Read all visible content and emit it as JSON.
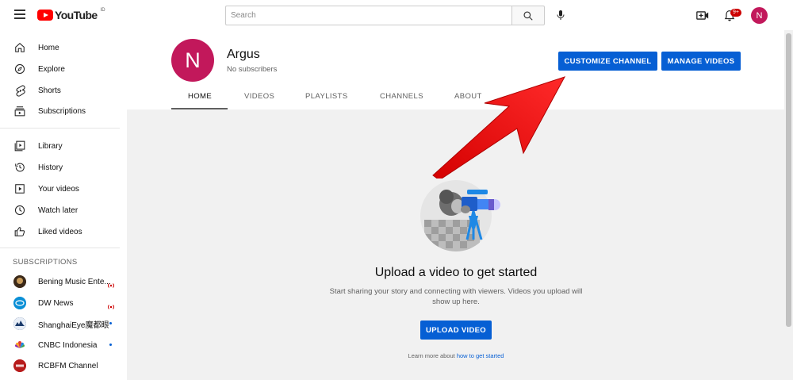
{
  "topbar": {
    "logo_text": "YouTube",
    "logo_region": "ID",
    "search_placeholder": "Search",
    "notification_count": "9+",
    "avatar_initial": "N"
  },
  "sidebar": {
    "main_items": [
      {
        "label": "Home",
        "icon": "home-icon"
      },
      {
        "label": "Explore",
        "icon": "compass-icon"
      },
      {
        "label": "Shorts",
        "icon": "shorts-icon"
      },
      {
        "label": "Subscriptions",
        "icon": "subscriptions-icon"
      }
    ],
    "library_items": [
      {
        "label": "Library",
        "icon": "library-icon"
      },
      {
        "label": "History",
        "icon": "history-icon"
      },
      {
        "label": "Your videos",
        "icon": "your-videos-icon"
      },
      {
        "label": "Watch later",
        "icon": "clock-icon"
      },
      {
        "label": "Liked videos",
        "icon": "thumbs-up-icon"
      }
    ],
    "subscriptions_header": "SUBSCRIPTIONS",
    "subscriptions": [
      {
        "label": "Bening Music Ente...",
        "status": "live",
        "color": "#6d4c2e"
      },
      {
        "label": "DW News",
        "status": "live",
        "color": "#0a8fd6"
      },
      {
        "label": "ShanghaiEye魔都眼",
        "status": "new",
        "color": "#1a3a6b"
      },
      {
        "label": "CNBC Indonesia",
        "status": "new",
        "color": "#ffffff"
      },
      {
        "label": "RCBFM Channel",
        "status": "",
        "color": "#b71c1c"
      }
    ]
  },
  "channel": {
    "avatar_initial": "N",
    "name": "Argus",
    "subscribers": "No subscribers",
    "customize_label": "CUSTOMIZE CHANNEL",
    "manage_label": "MANAGE VIDEOS",
    "tabs": [
      "HOME",
      "VIDEOS",
      "PLAYLISTS",
      "CHANNELS",
      "ABOUT"
    ],
    "active_tab": "HOME"
  },
  "empty_state": {
    "title": "Upload a video to get started",
    "description": "Start sharing your story and connecting with viewers. Videos you upload will show up here.",
    "upload_label": "UPLOAD VIDEO",
    "learn_prefix": "Learn more about ",
    "learn_link": "how to get started"
  },
  "colors": {
    "brand_red": "#ff0000",
    "button_blue": "#065fd4",
    "avatar": "#c2185b",
    "annotation_arrow": "#ee1111"
  }
}
